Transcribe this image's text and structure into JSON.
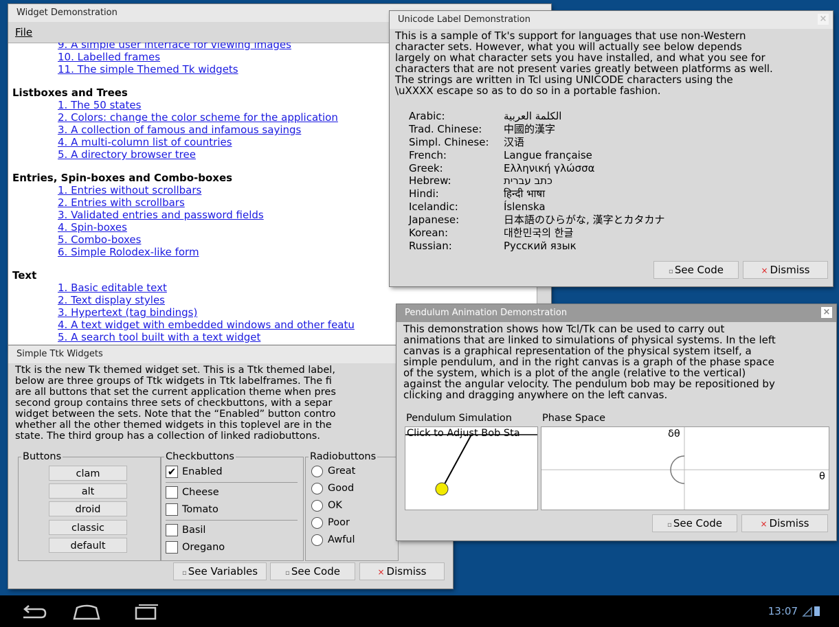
{
  "demo_window": {
    "title": "Widget Demonstration",
    "menu_file": "File",
    "top_links": [
      "9. A simple user interface for viewing images",
      "10. Labelled frames",
      "11. The simple Themed Tk widgets"
    ],
    "sections": [
      {
        "title": "Listboxes and Trees",
        "links": [
          "1. The 50 states",
          "2. Colors: change the color scheme for the application",
          "3. A collection of famous and infamous sayings",
          "4. A multi-column list of countries",
          "5. A directory browser tree"
        ]
      },
      {
        "title": "Entries, Spin-boxes and Combo-boxes",
        "links": [
          "1. Entries without scrollbars",
          "2. Entries with scrollbars",
          "3. Validated entries and password fields",
          "4. Spin-boxes",
          "5. Combo-boxes",
          "6. Simple Rolodex-like form"
        ]
      },
      {
        "title": "Text",
        "links": [
          "1. Basic editable text",
          "2. Text display styles",
          "3. Hypertext (tag bindings)",
          "4. A text widget with embedded windows and other featu",
          "5. A search tool built with a text widget"
        ]
      }
    ]
  },
  "ttk_window": {
    "title": "Simple Ttk Widgets",
    "text_lines": [
      "Ttk is the new Tk themed widget set. This is a Ttk themed label,",
      "below are three groups of Ttk widgets in Ttk labelframes. The fi",
      "are all buttons that set the current application theme when pres",
      "second group contains three sets of checkbuttons, with a separ",
      "widget between the sets. Note that the “Enabled” button contro",
      "whether all the other themed widgets in this toplevel are in the",
      "state. The third group has a collection of linked radiobuttons."
    ],
    "buttons_label": "Buttons",
    "theme_buttons": [
      "clam",
      "alt",
      "droid",
      "classic",
      "default"
    ],
    "checkbuttons_label": "Checkbuttons",
    "checkbuttons": [
      {
        "label": "Enabled",
        "checked": true,
        "mark": "✔"
      },
      {
        "label": "Cheese",
        "checked": false,
        "mark": ""
      },
      {
        "label": "Tomato",
        "checked": false,
        "mark": ""
      },
      {
        "label": "Basil",
        "checked": false,
        "mark": ""
      },
      {
        "label": "Oregano",
        "checked": false,
        "mark": ""
      }
    ],
    "radiobuttons_label": "Radiobuttons",
    "radiobuttons": [
      "Great",
      "Good",
      "OK",
      "Poor",
      "Awful"
    ],
    "see_variables": "See Variables",
    "see_code": "See Code",
    "dismiss": "Dismiss"
  },
  "unicode_window": {
    "title": "Unicode Label Demonstration",
    "text_lines": [
      "This is a sample of Tk's support for languages that use non-Western",
      "character sets.  However, what you will actually see below depends",
      "largely on what character sets you have installed, and what you see for",
      "characters that are not present varies greatly between platforms as well.",
      "The strings are written in Tcl using UNICODE characters using the",
      "\\uXXXX escape so as to do so in a portable fashion."
    ],
    "languages": [
      {
        "name": "Arabic:",
        "sample": "الكلمة العربية"
      },
      {
        "name": "Trad. Chinese:",
        "sample": "中國的漢字"
      },
      {
        "name": "Simpl. Chinese:",
        "sample": "汉语"
      },
      {
        "name": "French:",
        "sample": "Langue française"
      },
      {
        "name": "Greek:",
        "sample": "Ελληνική γλώσσα"
      },
      {
        "name": "Hebrew:",
        "sample": "כתב עברית"
      },
      {
        "name": "Hindi:",
        "sample": "हिन्दी भाषा"
      },
      {
        "name": "Icelandic:",
        "sample": "Íslenska"
      },
      {
        "name": "Japanese:",
        "sample": "日本語のひらがな, 漢字とカタカナ"
      },
      {
        "name": "Korean:",
        "sample": "대한민국의 한글"
      },
      {
        "name": "Russian:",
        "sample": "Русский язык"
      }
    ],
    "see_code": "See Code",
    "dismiss": "Dismiss"
  },
  "pendulum_window": {
    "title": "Pendulum Animation Demonstration",
    "text_lines": [
      "This demonstration shows how Tcl/Tk can be used to carry out",
      "animations that are linked to simulations of physical systems. In the left",
      "canvas is a graphical representation of the physical system itself, a",
      "simple pendulum, and in the right canvas is a graph of the phase space",
      "of the system, which is a plot of the angle (relative to the vertical)",
      "against the angular velocity. The pendulum bob may be repositioned by",
      "clicking and dragging anywhere on the left canvas."
    ],
    "sim_label": "Pendulum Simulation",
    "sim_hint": "Click to Adjust Bob Sta",
    "phase_label": "Phase Space",
    "phase_y": "δθ",
    "phase_x": "θ",
    "see_code": "See Code",
    "dismiss": "Dismiss"
  },
  "navbar": {
    "clock": "13:07",
    "back_icon": "back-icon",
    "home_icon": "home-icon",
    "recents_icon": "recents-icon"
  }
}
